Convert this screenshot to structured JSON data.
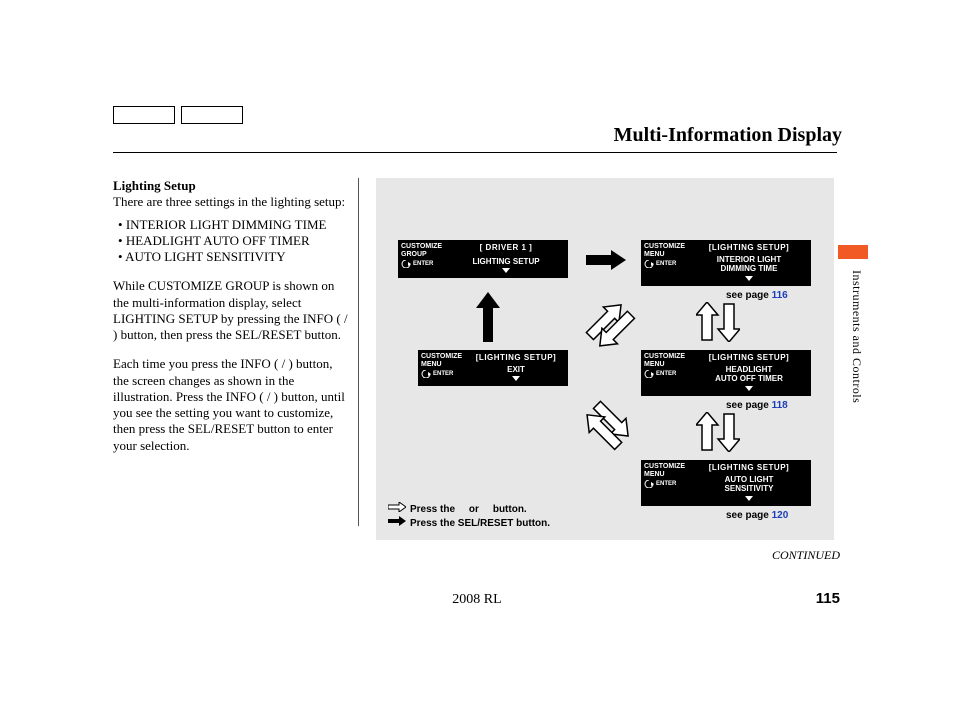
{
  "header": {
    "page_title": "Multi-Information Display"
  },
  "body": {
    "heading": "Lighting Setup",
    "intro": "There are three settings in the lighting setup:",
    "bullets": [
      "INTERIOR LIGHT DIMMING TIME",
      "HEADLIGHT AUTO OFF TIMER",
      "AUTO LIGHT SENSITIVITY"
    ],
    "para1": "While CUSTOMIZE GROUP is shown on the multi-information display, select LIGHTING SETUP by pressing the INFO (    /    ) button, then press the SEL/RESET button.",
    "para2": "Each time you press the INFO (    /     ) button, the screen changes as shown in the illustration. Press the INFO (    /    ) button, until you see the setting you want to customize, then press the SEL/RESET button to enter your selection."
  },
  "diagram": {
    "screens": {
      "group": {
        "left_label1": "CUSTOMIZE",
        "left_label2": "GROUP",
        "enter": "ENTER",
        "line1": "[ DRIVER 1 ]",
        "line2": "LIGHTING SETUP"
      },
      "exit": {
        "left_label1": "CUSTOMIZE",
        "left_label2": "MENU",
        "enter": "ENTER",
        "line1": "[LIGHTING SETUP]",
        "line2": "EXIT"
      },
      "interior": {
        "left_label1": "CUSTOMIZE",
        "left_label2": "MENU",
        "enter": "ENTER",
        "line1": "[LIGHTING SETUP]",
        "line2a": "INTERIOR LIGHT",
        "line2b": "DIMMING TIME"
      },
      "headlight": {
        "left_label1": "CUSTOMIZE",
        "left_label2": "MENU",
        "enter": "ENTER",
        "line1": "[LIGHTING SETUP]",
        "line2a": "HEADLIGHT",
        "line2b": "AUTO OFF TIMER"
      },
      "autolight": {
        "left_label1": "CUSTOMIZE",
        "left_label2": "MENU",
        "enter": "ENTER",
        "line1": "[LIGHTING SETUP]",
        "line2a": "AUTO LIGHT",
        "line2b": "SENSITIVITY"
      }
    },
    "captions": {
      "c1_prefix": "see page ",
      "c1_num": "116",
      "c2_prefix": "see page ",
      "c2_num": "118",
      "c3_prefix": "see page ",
      "c3_num": "120"
    },
    "legend": {
      "line1a": "Press the ",
      "line1b": " or ",
      "line1c": " button.",
      "line2": "Press the SEL/RESET button."
    }
  },
  "side": {
    "tab_label": "Instruments and Controls"
  },
  "footer": {
    "continued": "CONTINUED",
    "model": "2008  RL",
    "page_number": "115"
  }
}
